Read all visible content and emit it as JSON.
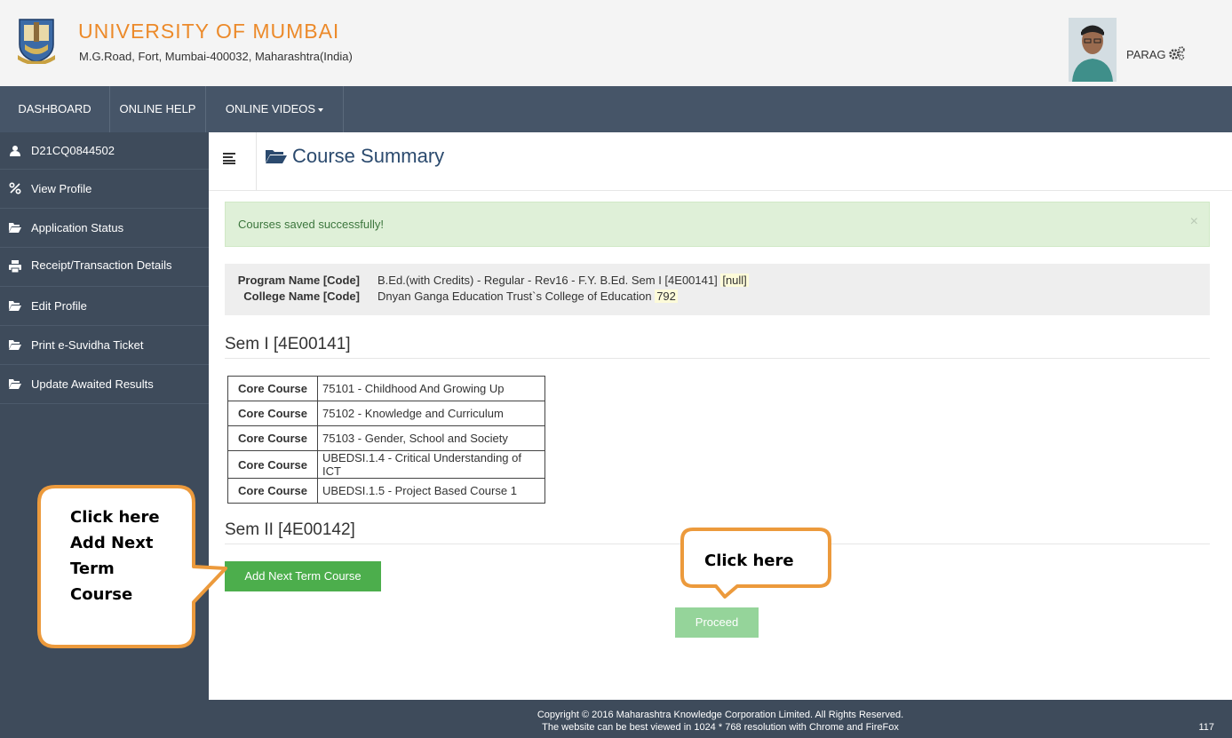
{
  "header": {
    "university_name": "UNIVERSITY OF MUMBAI",
    "address": "M.G.Road, Fort, Mumbai-400032, Maharashtra(India)",
    "username": "PARAG",
    "logo_icon": "university-crest",
    "settings_icon": "gear-icon"
  },
  "topnav": {
    "items": [
      {
        "label": "DASHBOARD"
      },
      {
        "label": "ONLINE HELP"
      },
      {
        "label": "ONLINE VIDEOS"
      }
    ]
  },
  "sidebar": {
    "items": [
      {
        "label": "D21CQ0844502",
        "icon": "user-icon"
      },
      {
        "label": "View Profile",
        "icon": "link-icon"
      },
      {
        "label": "Application Status",
        "icon": "folder-icon"
      },
      {
        "label": "Receipt/Transaction Details",
        "icon": "print-icon"
      },
      {
        "label": "Edit Profile",
        "icon": "folder-icon"
      },
      {
        "label": "Print e-Suvidha Ticket",
        "icon": "folder-icon"
      },
      {
        "label": "Update Awaited Results",
        "icon": "folder-icon"
      }
    ]
  },
  "page": {
    "title": "Course Summary",
    "alert": "Courses saved successfully!",
    "alert_close": "×",
    "program_label": "Program Name [Code]",
    "program_value": "B.Ed.(with Credits) - Regular - Rev16 - F.Y. B.Ed. Sem I [4E00141]",
    "program_code": "[null]",
    "college_label": "College Name [Code]",
    "college_value": "Dnyan Ganga Education Trust`s College of Education",
    "college_code": "792",
    "sem1_heading": "Sem I [4E00141]",
    "sem2_heading": "Sem II [4E00142]",
    "courses": [
      {
        "type": "Core Course",
        "name": "75101 - Childhood And Growing Up"
      },
      {
        "type": "Core Course",
        "name": "75102 - Knowledge and Curriculum"
      },
      {
        "type": "Core Course",
        "name": "75103 - Gender, School and Society"
      },
      {
        "type": "Core Course",
        "name": "UBEDSI.1.4 - Critical Understanding of ICT"
      },
      {
        "type": "Core Course",
        "name": "UBEDSI.1.5 - Project Based Course 1"
      }
    ],
    "add_button": "Add Next Term Course",
    "proceed_button": "Proceed"
  },
  "callouts": {
    "left_lines": [
      "Click here",
      "Add Next",
      "Term",
      "Course"
    ],
    "right": "Click here"
  },
  "footer": {
    "line1": "Copyright © 2016 Maharashtra Knowledge Corporation Limited. All Rights Reserved.",
    "line2": "The website can be best viewed in 1024 * 768 resolution with Chrome and FireFox",
    "number": "117"
  },
  "colors": {
    "brand_orange": "#ec8a2a",
    "nav_bg": "#465568",
    "sidebar_bg": "#3e4b5b",
    "success_green": "#4cae4c",
    "alert_bg": "#dff0d8",
    "callout_border": "#ec9a3c"
  }
}
